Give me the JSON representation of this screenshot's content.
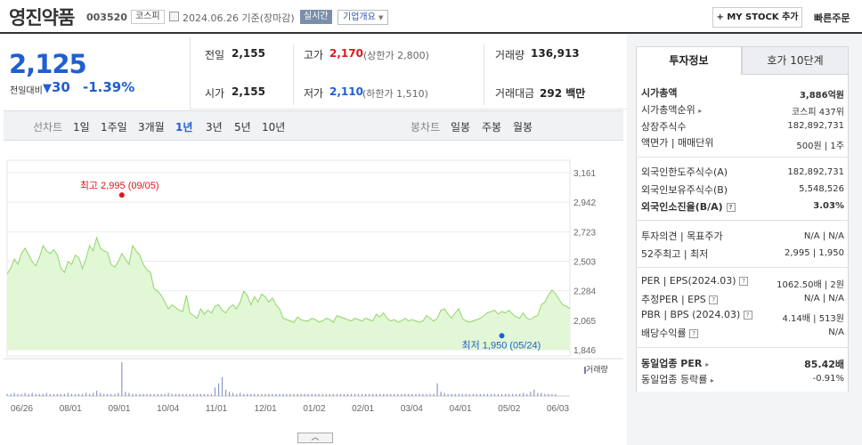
{
  "header": {
    "company": "영진약품",
    "code": "003520",
    "market": "코스피",
    "date": "2024.06.26 기준(장마감)",
    "realtime": "실시간",
    "corp_overview": "기업개요",
    "my_stock": "+ MY STOCK 추가",
    "quick_order": "빠른주문"
  },
  "price": {
    "current": "2,125",
    "change_label": "전일대비",
    "change_value": "30",
    "change_pct": "-1.39%"
  },
  "quote": {
    "prev_label": "전일",
    "prev_value": "2,155",
    "open_label": "시가",
    "open_value": "2,155",
    "high_label": "고가",
    "high_value": "2,170",
    "upper_limit": "(상한가 2,800)",
    "low_label": "저가",
    "low_value": "2,110",
    "lower_limit": "(하한가 1,510)",
    "volume_label": "거래량",
    "volume_value": "136,913",
    "amount_label": "거래대금",
    "amount_value": "292",
    "amount_unit": "백만"
  },
  "period_bar": {
    "line_label": "선차트",
    "periods": [
      "1일",
      "1주일",
      "3개월",
      "1년",
      "3년",
      "5년",
      "10년"
    ],
    "selected": "1년",
    "candle_label": "봉차트",
    "candles": [
      "일봉",
      "주봉",
      "월봉"
    ]
  },
  "chart_data": {
    "type": "area",
    "x_ticks": [
      "06/26",
      "08/01",
      "09/01",
      "10/04",
      "11/01",
      "12/01",
      "01/02",
      "02/01",
      "03/04",
      "04/01",
      "05/02",
      "06/03"
    ],
    "y_ticks": [
      "3,161",
      "2,942",
      "2,723",
      "2,503",
      "2,284",
      "2,065",
      "1,846"
    ],
    "ylim": [
      1846,
      3161
    ],
    "high_label": "최고 2,995 (09/05)",
    "low_label": "최저 1,950 (05/24)",
    "volume_label": "거래량",
    "values": [
      2410,
      2450,
      2520,
      2480,
      2560,
      2600,
      2550,
      2500,
      2470,
      2530,
      2620,
      2580,
      2560,
      2590,
      2550,
      2450,
      2420,
      2500,
      2480,
      2550,
      2530,
      2450,
      2520,
      2620,
      2580,
      2680,
      2600,
      2580,
      2570,
      2480,
      2460,
      2500,
      2560,
      2520,
      2480,
      2620,
      2580,
      2550,
      2480,
      2440,
      2420,
      2300,
      2280,
      2250,
      2200,
      2150,
      2180,
      2160,
      2140,
      2130,
      2250,
      2120,
      2100,
      2080,
      2150,
      2110,
      2140,
      2120,
      2170,
      2180,
      2140,
      2120,
      2160,
      2180,
      2150,
      2200,
      2280,
      2250,
      2180,
      2240,
      2200,
      2260,
      2240,
      2200,
      2230,
      2180,
      2150,
      2080,
      2070,
      2060,
      2050,
      2090,
      2070,
      2060,
      2060,
      2080,
      2070,
      2050,
      2060,
      2080,
      2070,
      2050,
      2100,
      2090,
      2080,
      2070,
      2060,
      2080,
      2070,
      2060,
      2080,
      2070,
      2060,
      2110,
      2090,
      2120,
      2080,
      2060,
      2070,
      2050,
      2060,
      2080,
      2060,
      2070,
      2060,
      2050,
      2060,
      2100,
      2080,
      2060,
      2080,
      2140,
      2150,
      2110,
      2080,
      2120,
      2150,
      2080,
      2060,
      2050,
      2060,
      2070,
      2080,
      2100,
      2120,
      2130,
      2140,
      2110,
      2130,
      2120,
      2140,
      2110,
      2090,
      2080,
      2120,
      2080,
      2070,
      2090,
      2100,
      2180,
      2200,
      2250,
      2290,
      2260,
      2220,
      2180,
      2170,
      2150
    ],
    "volume": [
      2,
      2,
      3,
      2,
      2,
      3,
      2,
      3,
      2,
      2,
      2,
      3,
      2,
      2,
      2,
      2,
      2,
      3,
      2,
      2,
      2,
      2,
      3,
      2,
      3,
      5,
      3,
      2,
      2,
      2,
      2,
      3,
      32,
      4,
      3,
      2,
      2,
      2,
      2,
      2,
      2,
      2,
      2,
      2,
      2,
      3,
      2,
      2,
      2,
      2,
      2,
      2,
      2,
      2,
      2,
      2,
      2,
      2,
      8,
      12,
      18,
      6,
      4,
      3,
      2,
      3,
      2,
      2,
      2,
      2,
      2,
      2,
      2,
      2,
      2,
      2,
      2,
      2,
      2,
      2,
      2,
      2,
      2,
      2,
      2,
      2,
      2,
      2,
      2,
      2,
      2,
      2,
      2,
      2,
      2,
      2,
      2,
      2,
      2,
      2,
      2,
      2,
      2,
      2,
      2,
      2,
      2,
      2,
      2,
      2,
      2,
      2,
      2,
      2,
      2,
      2,
      2,
      2,
      2,
      2,
      12,
      4,
      3,
      2,
      2,
      2,
      2,
      2,
      2,
      2,
      2,
      2,
      2,
      2,
      2,
      2,
      2,
      2,
      2,
      2,
      2,
      2,
      2,
      2,
      3,
      2,
      4,
      6,
      3,
      3,
      2,
      2,
      2,
      2
    ],
    "high_point": {
      "x": "09/05",
      "y": 2995
    },
    "low_point": {
      "x": "05/24",
      "y": 1950
    }
  },
  "right_panel": {
    "tab_invest": "투자정보",
    "tab_hoga": "호가 10단계",
    "market_cap_label": "시가총액",
    "market_cap_value": "3,886억원",
    "cap_rank_label": "시가총액순위",
    "cap_rank_value": "코스피 437위",
    "shares_label": "상장주식수",
    "shares_value": "182,892,731",
    "par_label": "액면가 | 매매단위",
    "par_value": "500원 | 1주",
    "foreign_limit_label": "외국인한도주식수(A)",
    "foreign_limit_value": "182,892,731",
    "foreign_hold_label": "외국인보유주식수(B)",
    "foreign_hold_value": "5,548,526",
    "foreign_ratio_label": "외국인소진율(B/A)",
    "foreign_ratio_value": "3.03%",
    "opinion_label": "투자의견 | 목표주가",
    "opinion_value": "N/A | N/A",
    "week52_label": "52주최고 | 최저",
    "week52_value": "2,995 | 1,950",
    "per_label": "PER | EPS(2024.03)",
    "per_value": "1062.50배 | 2원",
    "est_per_label": "추정PER | EPS",
    "est_per_value": "N/A | N/A",
    "pbr_label": "PBR | BPS (2024.03)",
    "pbr_value": "4.14배 | 513원",
    "div_label": "배당수익률",
    "div_value": "N/A",
    "ind_per_label": "동일업종 PER",
    "ind_per_value": "85.42배",
    "ind_rate_label": "동일업종 등락률",
    "ind_rate_value": "-0.91%"
  }
}
